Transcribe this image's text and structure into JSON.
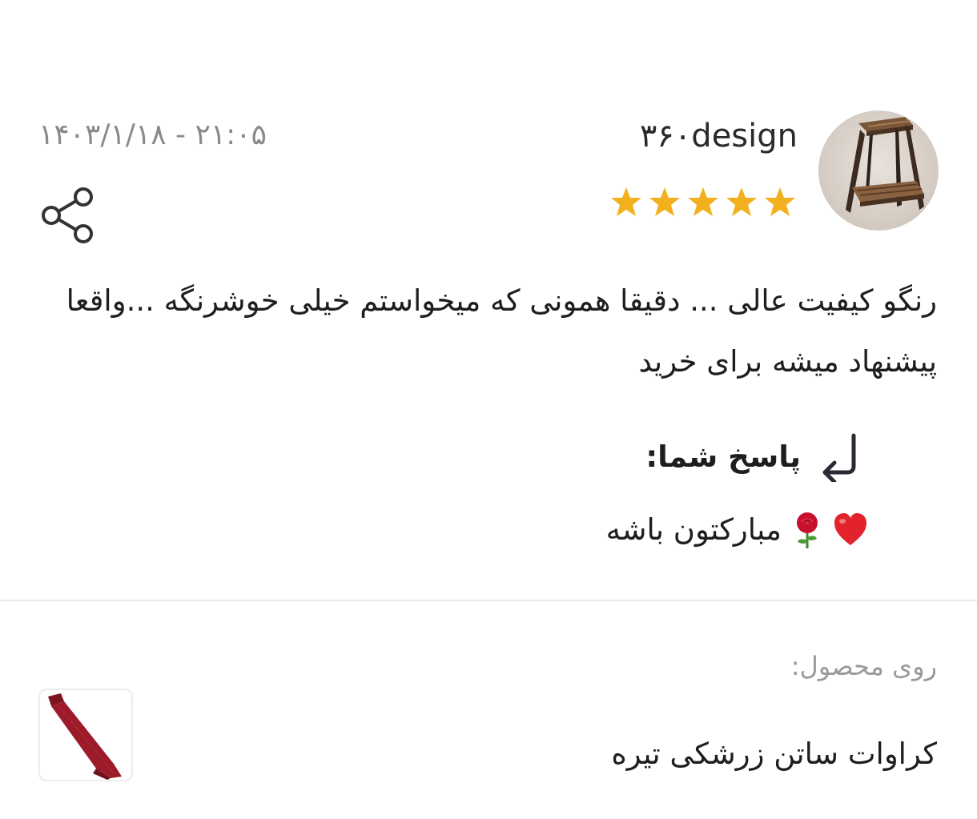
{
  "review": {
    "username": "۳۶۰design",
    "avatar_icon": "wooden-stool-avatar",
    "rating": 5,
    "rating_max": 5,
    "star_color": "#f2b01e",
    "date": "۱۴۰۳/۱/۱۸ - ۲۱:۰۵",
    "share_icon": "share-icon",
    "comment_line1": "رنگو کیفیت عالی ... دقیقا همونی که میخواستم خیلی خوشرنگه ...واقعا",
    "comment_line2": "پیشنهاد میشه برای خرید"
  },
  "reply": {
    "icon": "reply-arrow-icon",
    "label": "پاسخ شما:",
    "text": "مبارکتون باشه",
    "emojis": [
      "rose-icon",
      "red-heart-icon"
    ]
  },
  "product": {
    "section_label": "روی محصول:",
    "name": "کراوات ساتن زرشکی تیره",
    "thumbnail_icon": "red-necktie-thumbnail",
    "tie_color": "#9b1b2a"
  }
}
